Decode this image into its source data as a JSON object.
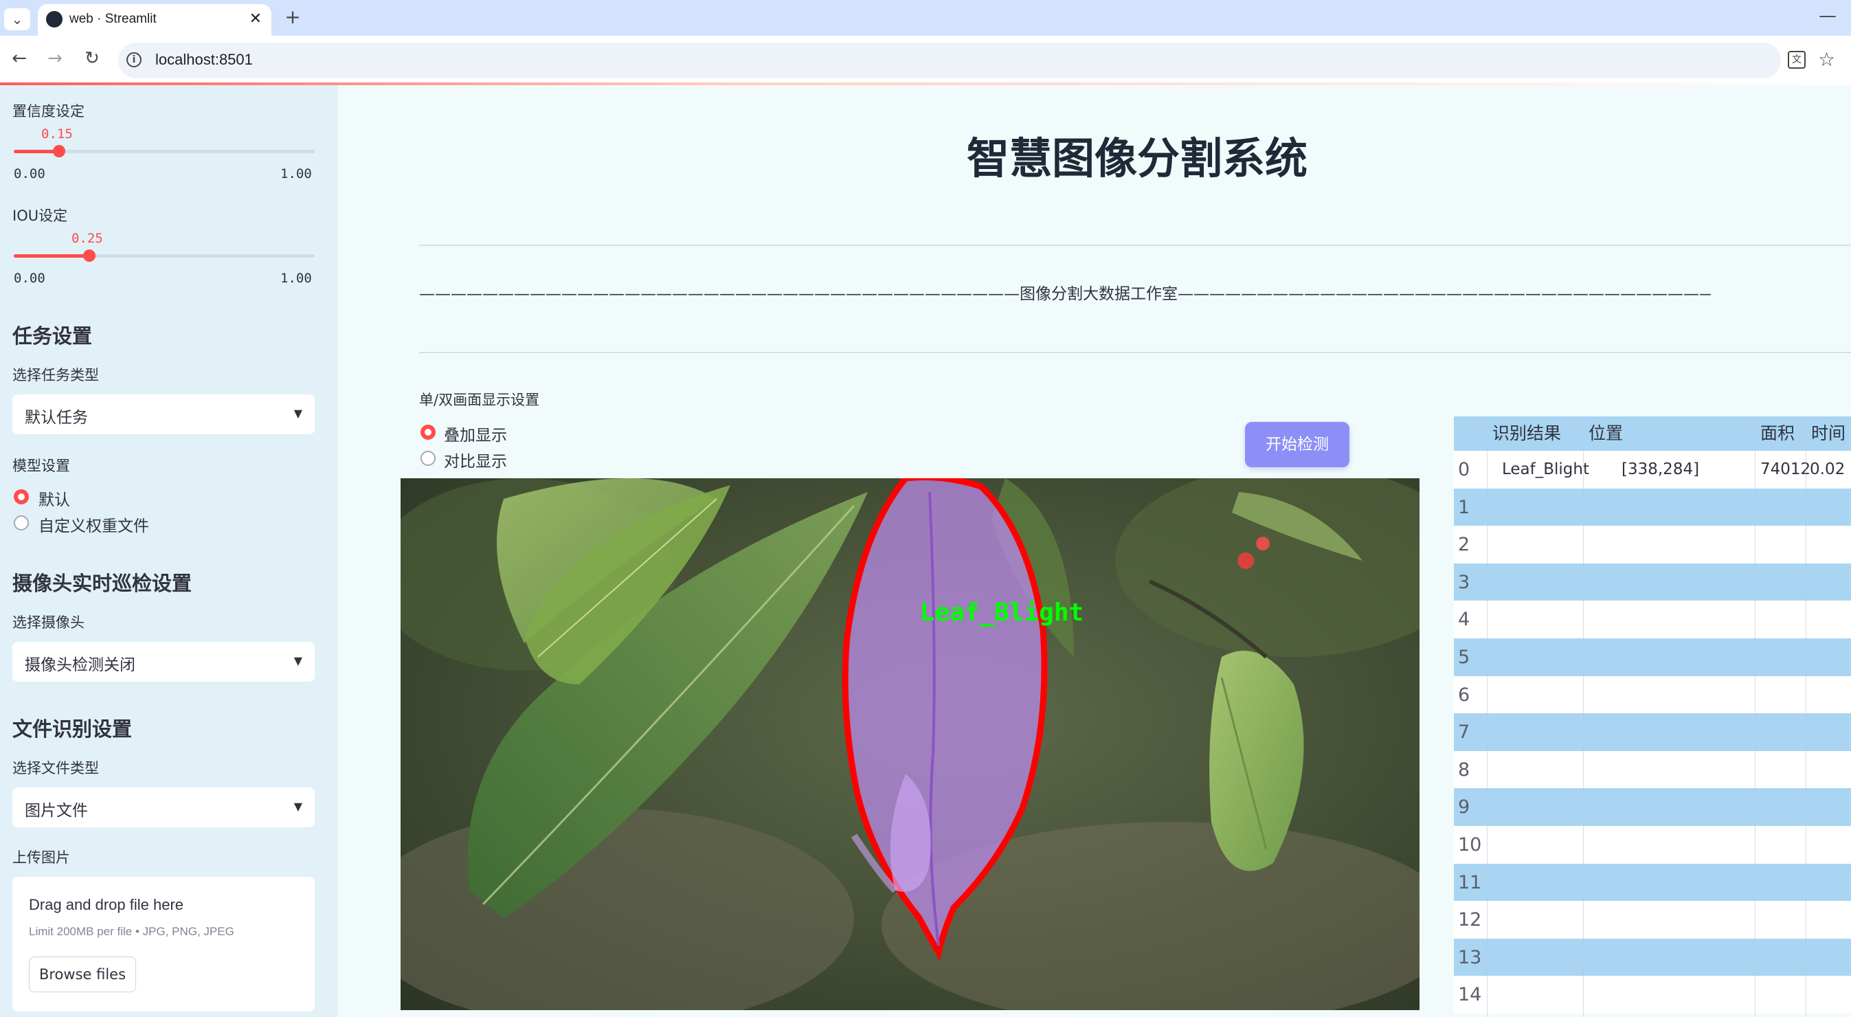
{
  "browser": {
    "tab_title": "web · Streamlit",
    "url": "localhost:8501"
  },
  "sidebar": {
    "confidence": {
      "label": "置信度设定",
      "value": "0.15",
      "min": "0.00",
      "max": "1.00",
      "fraction": 0.15
    },
    "iou": {
      "label": "IOU设定",
      "value": "0.25",
      "min": "0.00",
      "max": "1.00",
      "fraction": 0.25
    },
    "task_section": {
      "heading": "任务设置",
      "select_label": "选择任务类型",
      "selected": "默认任务"
    },
    "model_section": {
      "label": "模型设置",
      "options": [
        "默认",
        "自定义权重文件"
      ],
      "selected_index": 0
    },
    "camera_section": {
      "heading": "摄像头实时巡检设置",
      "select_label": "选择摄像头",
      "selected": "摄像头检测关闭"
    },
    "file_section": {
      "heading": "文件识别设置",
      "select_label": "选择文件类型",
      "selected": "图片文件"
    },
    "upload": {
      "label": "上传图片",
      "drop_text": "Drag and drop file here",
      "limit_text": "Limit 200MB per file • JPG, PNG, JPEG",
      "browse_label": "Browse files"
    }
  },
  "main": {
    "title": "智慧图像分割系统",
    "studio_line": "——————————————————————————————————————图像分割大数据工作室———————————————————————————————————————",
    "display_mode": {
      "label": "单/双画面显示设置",
      "options": [
        "叠加显示",
        "对比显示"
      ],
      "selected_index": 0
    },
    "start_button": "开始检测",
    "detection_label": "Leaf_Blight"
  },
  "results_table": {
    "columns": [
      "识别结果",
      "位置",
      "面积",
      "时间"
    ],
    "rows": [
      {
        "index": "0",
        "result": "Leaf_Blight",
        "position": "[338,284]",
        "area": "74012",
        "time": "0.02"
      },
      {
        "index": "1",
        "result": "",
        "position": "",
        "area": "",
        "time": ""
      },
      {
        "index": "2",
        "result": "",
        "position": "",
        "area": "",
        "time": ""
      },
      {
        "index": "3",
        "result": "",
        "position": "",
        "area": "",
        "time": ""
      },
      {
        "index": "4",
        "result": "",
        "position": "",
        "area": "",
        "time": ""
      },
      {
        "index": "5",
        "result": "",
        "position": "",
        "area": "",
        "time": ""
      },
      {
        "index": "6",
        "result": "",
        "position": "",
        "area": "",
        "time": ""
      },
      {
        "index": "7",
        "result": "",
        "position": "",
        "area": "",
        "time": ""
      },
      {
        "index": "8",
        "result": "",
        "position": "",
        "area": "",
        "time": ""
      },
      {
        "index": "9",
        "result": "",
        "position": "",
        "area": "",
        "time": ""
      },
      {
        "index": "10",
        "result": "",
        "position": "",
        "area": "",
        "time": ""
      },
      {
        "index": "11",
        "result": "",
        "position": "",
        "area": "",
        "time": ""
      },
      {
        "index": "12",
        "result": "",
        "position": "",
        "area": "",
        "time": ""
      },
      {
        "index": "13",
        "result": "",
        "position": "",
        "area": "",
        "time": ""
      },
      {
        "index": "14",
        "result": "",
        "position": "",
        "area": "",
        "time": ""
      }
    ]
  },
  "colors": {
    "accent": "#ff4b4b",
    "sidebar_bg": "#e2f1f8",
    "table_stripe": "#a9d5f2",
    "start_button": "#8b8ff6",
    "mask_outline": "#ff0000",
    "mask_fill": "#b98ae8",
    "label_text": "#00ff00"
  }
}
